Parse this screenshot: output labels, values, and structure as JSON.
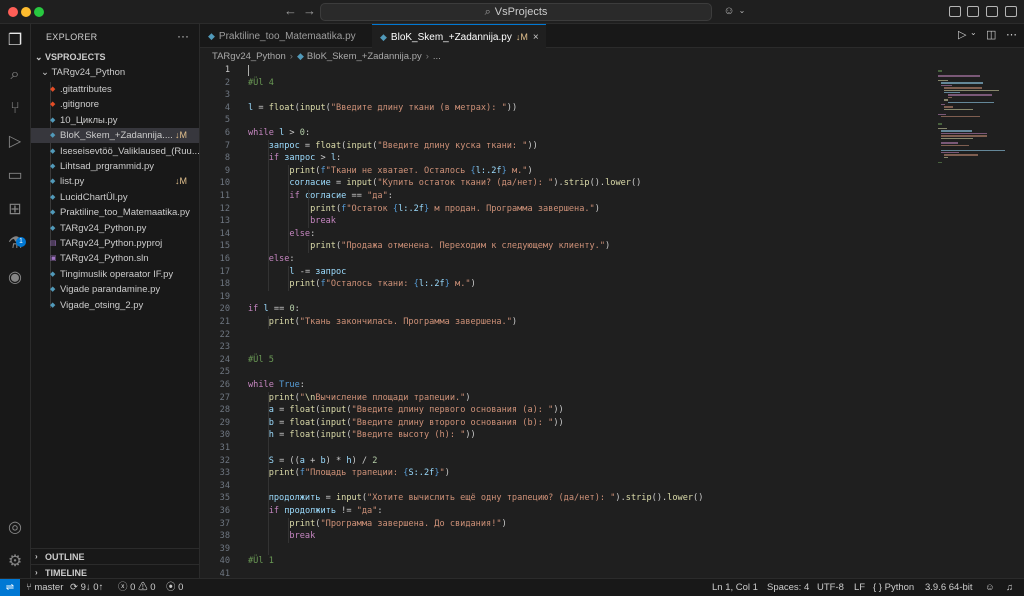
{
  "window": {
    "search_text": "VsProjects",
    "search_icon": "search-icon",
    "nav_back": "back-arrow-icon",
    "nav_forward": "forward-arrow-icon"
  },
  "activity_bar": [
    {
      "name": "explorer-icon",
      "glyph": "❐"
    },
    {
      "name": "search-icon",
      "glyph": "⌕"
    },
    {
      "name": "source-control-icon",
      "glyph": "⑂"
    },
    {
      "name": "run-debug-icon",
      "glyph": "▷"
    },
    {
      "name": "remote-explorer-icon",
      "glyph": "▭"
    },
    {
      "name": "extensions-icon",
      "glyph": "⊞"
    },
    {
      "name": "testing-icon",
      "glyph": "⚗"
    },
    {
      "name": "github-icon",
      "glyph": "◉"
    }
  ],
  "extensions_badge": "1",
  "sidebar": {
    "title": "EXPLORER",
    "more": "···",
    "root": "VSPROJECTS",
    "folder": "TARgv24_Python",
    "files": [
      {
        "name": ".gitattributes",
        "icon": "git",
        "status": ""
      },
      {
        "name": ".gitignore",
        "icon": "git",
        "status": ""
      },
      {
        "name": "10_Циклы.py",
        "icon": "py",
        "status": ""
      },
      {
        "name": "BloK_Skem_+Zadannija....",
        "icon": "py",
        "status": "↓M",
        "selected": true
      },
      {
        "name": "Iseseisevtöö_Valiklaused_(Ruu...",
        "icon": "py",
        "status": ""
      },
      {
        "name": "Lihtsad_prgrammid.py",
        "icon": "py",
        "status": ""
      },
      {
        "name": "list.py",
        "icon": "py",
        "status": "↓M"
      },
      {
        "name": "LucidChartÜl.py",
        "icon": "py",
        "status": ""
      },
      {
        "name": "Praktiline_too_Matemaatika.py",
        "icon": "py",
        "status": ""
      },
      {
        "name": "TARgv24_Python.py",
        "icon": "py",
        "status": ""
      },
      {
        "name": "TARgv24_Python.pyproj",
        "icon": "proj",
        "status": ""
      },
      {
        "name": "TARgv24_Python.sln",
        "icon": "sln",
        "status": ""
      },
      {
        "name": "Tingimuslik operaator IF.py",
        "icon": "py",
        "status": ""
      },
      {
        "name": "Vigade parandamine.py",
        "icon": "py",
        "status": ""
      },
      {
        "name": "Vigade_otsing_2.py",
        "icon": "py",
        "status": ""
      }
    ],
    "outline": "OUTLINE",
    "timeline": "TIMELINE"
  },
  "tabs": [
    {
      "label": "Praktiline_too_Matemaatika.py",
      "active": false,
      "status": ""
    },
    {
      "label": "BloK_Skem_+Zadannija.py",
      "active": true,
      "status": "↓M"
    }
  ],
  "breadcrumb": {
    "folder": "TARgv24_Python",
    "file": "BloK_Skem_+Zadannija.py",
    "more": "..."
  },
  "code_lines": [
    {
      "n": 1,
      "t": ""
    },
    {
      "n": 2,
      "t": "#Ül 4"
    },
    {
      "n": 3,
      "t": ""
    },
    {
      "n": 4,
      "t": "l = float(input(\"Введите длину ткани (в метрах): \"))"
    },
    {
      "n": 5,
      "t": ""
    },
    {
      "n": 6,
      "t": "while l > 0:"
    },
    {
      "n": 7,
      "t": "    запрос = float(input(\"Введите длину куска ткани: \"))"
    },
    {
      "n": 8,
      "t": "    if запрос > l:"
    },
    {
      "n": 9,
      "t": "        print(f\"Ткани не хватает. Осталось {l:.2f} м.\")"
    },
    {
      "n": 10,
      "t": "        согласие = input(\"Купить остаток ткани? (да/нет): \").strip().lower()"
    },
    {
      "n": 11,
      "t": "        if согласие == \"да\":"
    },
    {
      "n": 12,
      "t": "            print(f\"Остаток {l:.2f} м продан. Программа завершена.\")"
    },
    {
      "n": 13,
      "t": "            break"
    },
    {
      "n": 14,
      "t": "        else:"
    },
    {
      "n": 15,
      "t": "            print(\"Продажа отменена. Переходим к следующему клиенту.\")"
    },
    {
      "n": 16,
      "t": "    else:"
    },
    {
      "n": 17,
      "t": "        l -= запрос"
    },
    {
      "n": 18,
      "t": "        print(f\"Осталось ткани: {l:.2f} м.\")"
    },
    {
      "n": 19,
      "t": ""
    },
    {
      "n": 20,
      "t": "if l == 0:"
    },
    {
      "n": 21,
      "t": "    print(\"Ткань закончилась. Программа завершена.\")"
    },
    {
      "n": 22,
      "t": ""
    },
    {
      "n": 23,
      "t": ""
    },
    {
      "n": 24,
      "t": "#Ül 5"
    },
    {
      "n": 25,
      "t": ""
    },
    {
      "n": 26,
      "t": "while True:"
    },
    {
      "n": 27,
      "t": "    print(\"\\nВычисление площади трапеции.\")"
    },
    {
      "n": 28,
      "t": "    a = float(input(\"Введите длину первого основания (a): \"))"
    },
    {
      "n": 29,
      "t": "    b = float(input(\"Введите длину второго основания (b): \"))"
    },
    {
      "n": 30,
      "t": "    h = float(input(\"Введите высоту (h): \"))"
    },
    {
      "n": 31,
      "t": ""
    },
    {
      "n": 32,
      "t": "    S = ((a + b) * h) / 2"
    },
    {
      "n": 33,
      "t": "    print(f\"Площадь трапеции: {S:.2f}\")"
    },
    {
      "n": 34,
      "t": ""
    },
    {
      "n": 35,
      "t": "    продолжить = input(\"Хотите вычислить ещё одну трапецию? (да/нет): \").strip().lower()"
    },
    {
      "n": 36,
      "t": "    if продолжить != \"да\":"
    },
    {
      "n": 37,
      "t": "        print(\"Программа завершена. До свидания!\")"
    },
    {
      "n": 38,
      "t": "        break"
    },
    {
      "n": 39,
      "t": ""
    },
    {
      "n": 40,
      "t": "#Ül 1"
    },
    {
      "n": 41,
      "t": ""
    }
  ],
  "status_bar": {
    "branch": "master",
    "sync": "9↓ 0↑",
    "errors": "0",
    "warnings": "0",
    "ports": "0",
    "position": "Ln 1, Col 1",
    "spaces": "Spaces: 4",
    "encoding": "UTF-8",
    "eol": "LF",
    "language": "Python",
    "interpreter": "3.9.6 64-bit"
  },
  "colors": {
    "accent": "#0078d4",
    "modified": "#e2c08d",
    "python_icon": "#519aba"
  }
}
